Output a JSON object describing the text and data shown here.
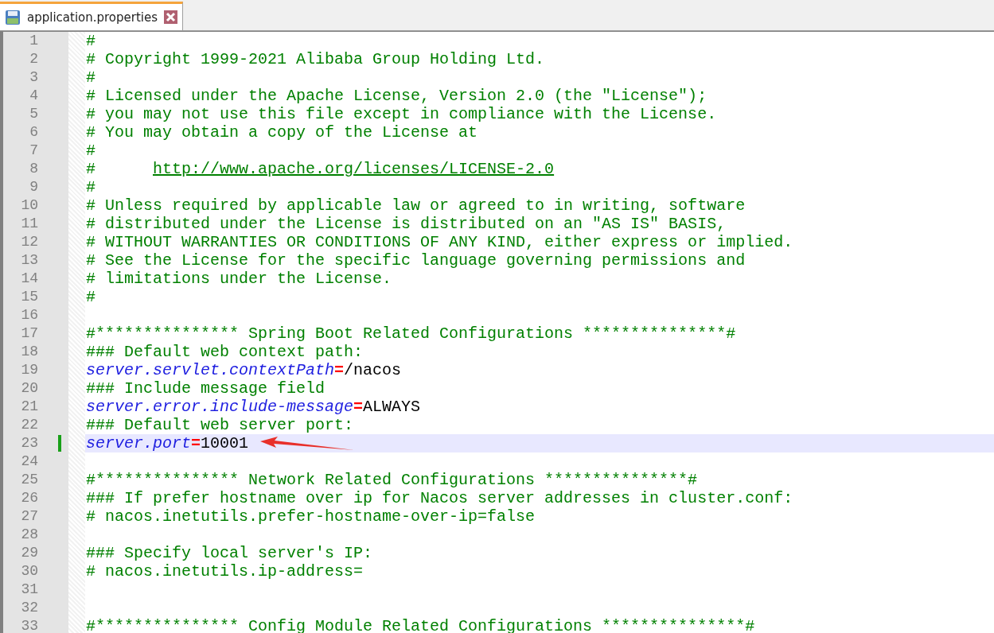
{
  "tabs": [
    {
      "label": "application.properties",
      "selected": true
    }
  ],
  "editor": {
    "lines": [
      {
        "number": "1",
        "kind": "comment",
        "text": "#",
        "current": false,
        "changed": false
      },
      {
        "number": "2",
        "kind": "comment",
        "text": "# Copyright 1999-2021 Alibaba Group Holding Ltd.",
        "current": false,
        "changed": false
      },
      {
        "number": "3",
        "kind": "comment",
        "text": "#",
        "current": false,
        "changed": false
      },
      {
        "number": "4",
        "kind": "comment",
        "text": "# Licensed under the Apache License, Version 2.0 (the \"License\");",
        "current": false,
        "changed": false
      },
      {
        "number": "5",
        "kind": "comment",
        "text": "# you may not use this file except in compliance with the License.",
        "current": false,
        "changed": false
      },
      {
        "number": "6",
        "kind": "comment",
        "text": "# You may obtain a copy of the License at",
        "current": false,
        "changed": false
      },
      {
        "number": "7",
        "kind": "comment",
        "text": "#",
        "current": false,
        "changed": false
      },
      {
        "number": "8",
        "kind": "link",
        "text": "#      ",
        "url": "http://www.apache.org/licenses/LICENSE-2.0",
        "current": false,
        "changed": false
      },
      {
        "number": "9",
        "kind": "comment",
        "text": "#",
        "current": false,
        "changed": false
      },
      {
        "number": "10",
        "kind": "comment",
        "text": "# Unless required by applicable law or agreed to in writing, software",
        "current": false,
        "changed": false
      },
      {
        "number": "11",
        "kind": "comment",
        "text": "# distributed under the License is distributed on an \"AS IS\" BASIS,",
        "current": false,
        "changed": false
      },
      {
        "number": "12",
        "kind": "comment",
        "text": "# WITHOUT WARRANTIES OR CONDITIONS OF ANY KIND, either express or implied.",
        "current": false,
        "changed": false
      },
      {
        "number": "13",
        "kind": "comment",
        "text": "# See the License for the specific language governing permissions and",
        "current": false,
        "changed": false
      },
      {
        "number": "14",
        "kind": "comment",
        "text": "# limitations under the License.",
        "current": false,
        "changed": false
      },
      {
        "number": "15",
        "kind": "comment",
        "text": "#",
        "current": false,
        "changed": false
      },
      {
        "number": "16",
        "kind": "blank",
        "current": false,
        "changed": false
      },
      {
        "number": "17",
        "kind": "comment",
        "text": "#*************** Spring Boot Related Configurations ***************#",
        "current": false,
        "changed": false
      },
      {
        "number": "18",
        "kind": "comment",
        "text": "### Default web context path:",
        "current": false,
        "changed": false
      },
      {
        "number": "19",
        "kind": "property",
        "key": "server.servlet.contextPath",
        "separator": "=",
        "value": "/nacos",
        "current": false,
        "changed": false
      },
      {
        "number": "20",
        "kind": "comment",
        "text": "### Include message field",
        "current": false,
        "changed": false
      },
      {
        "number": "21",
        "kind": "property",
        "key": "server.error.include-message",
        "separator": "=",
        "value": "ALWAYS",
        "current": false,
        "changed": false
      },
      {
        "number": "22",
        "kind": "comment",
        "text": "### Default web server port:",
        "current": false,
        "changed": false
      },
      {
        "number": "23",
        "kind": "property",
        "key": "server.port",
        "separator": "=",
        "value": "10001",
        "current": true,
        "changed": true
      },
      {
        "number": "24",
        "kind": "blank",
        "current": false,
        "changed": false
      },
      {
        "number": "25",
        "kind": "comment",
        "text": "#*************** Network Related Configurations ***************#",
        "current": false,
        "changed": false
      },
      {
        "number": "26",
        "kind": "comment",
        "text": "### If prefer hostname over ip for Nacos server addresses in cluster.conf:",
        "current": false,
        "changed": false
      },
      {
        "number": "27",
        "kind": "comment",
        "text": "# nacos.inetutils.prefer-hostname-over-ip=false",
        "current": false,
        "changed": false
      },
      {
        "number": "28",
        "kind": "blank",
        "current": false,
        "changed": false
      },
      {
        "number": "29",
        "kind": "comment",
        "text": "### Specify local server's IP:",
        "current": false,
        "changed": false
      },
      {
        "number": "30",
        "kind": "comment",
        "text": "# nacos.inetutils.ip-address=",
        "current": false,
        "changed": false
      },
      {
        "number": "31",
        "kind": "blank",
        "current": false,
        "changed": false
      },
      {
        "number": "32",
        "kind": "blank",
        "current": false,
        "changed": false
      },
      {
        "number": "33",
        "kind": "comment",
        "text": "#*************** Config Module Related Configurations ***************#",
        "current": false,
        "changed": false
      }
    ]
  }
}
